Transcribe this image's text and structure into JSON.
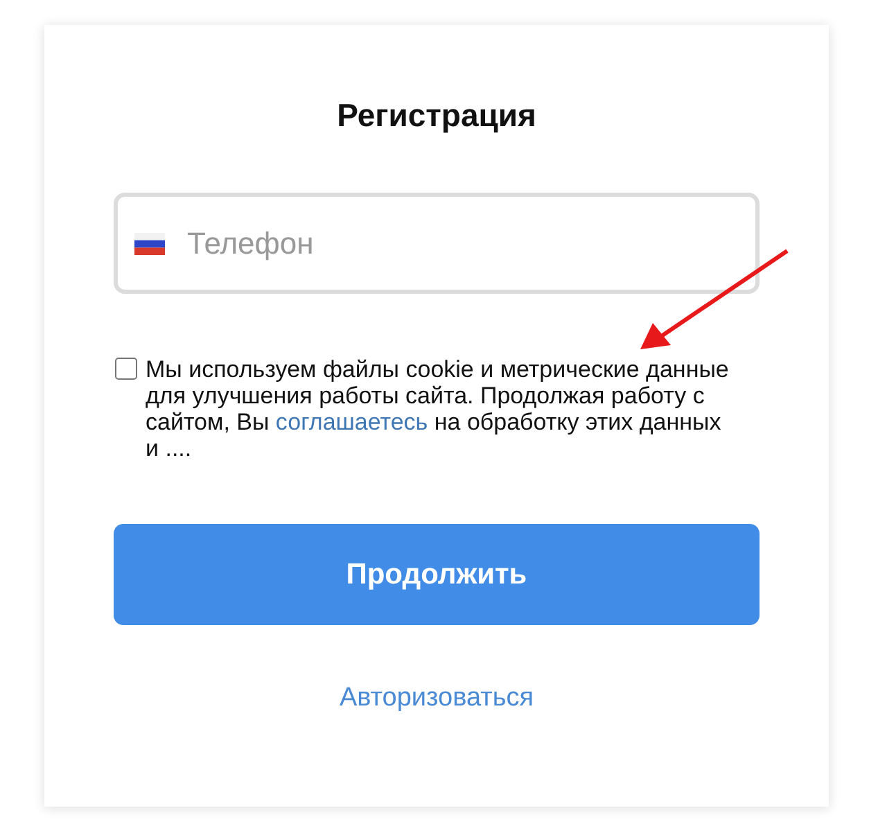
{
  "title": "Регистрация",
  "phone_field": {
    "placeholder": "Телефон"
  },
  "consent": {
    "checked": false,
    "text_before": "Мы используем файлы cookie и метрические данные для улучшения работы сайта. Продолжая работу с сайтом, Вы ",
    "link": "соглашаетесь",
    "text_after": " на обработку этих данных и ...."
  },
  "continue_button": "Продолжить",
  "login_link": "Авторизоваться"
}
